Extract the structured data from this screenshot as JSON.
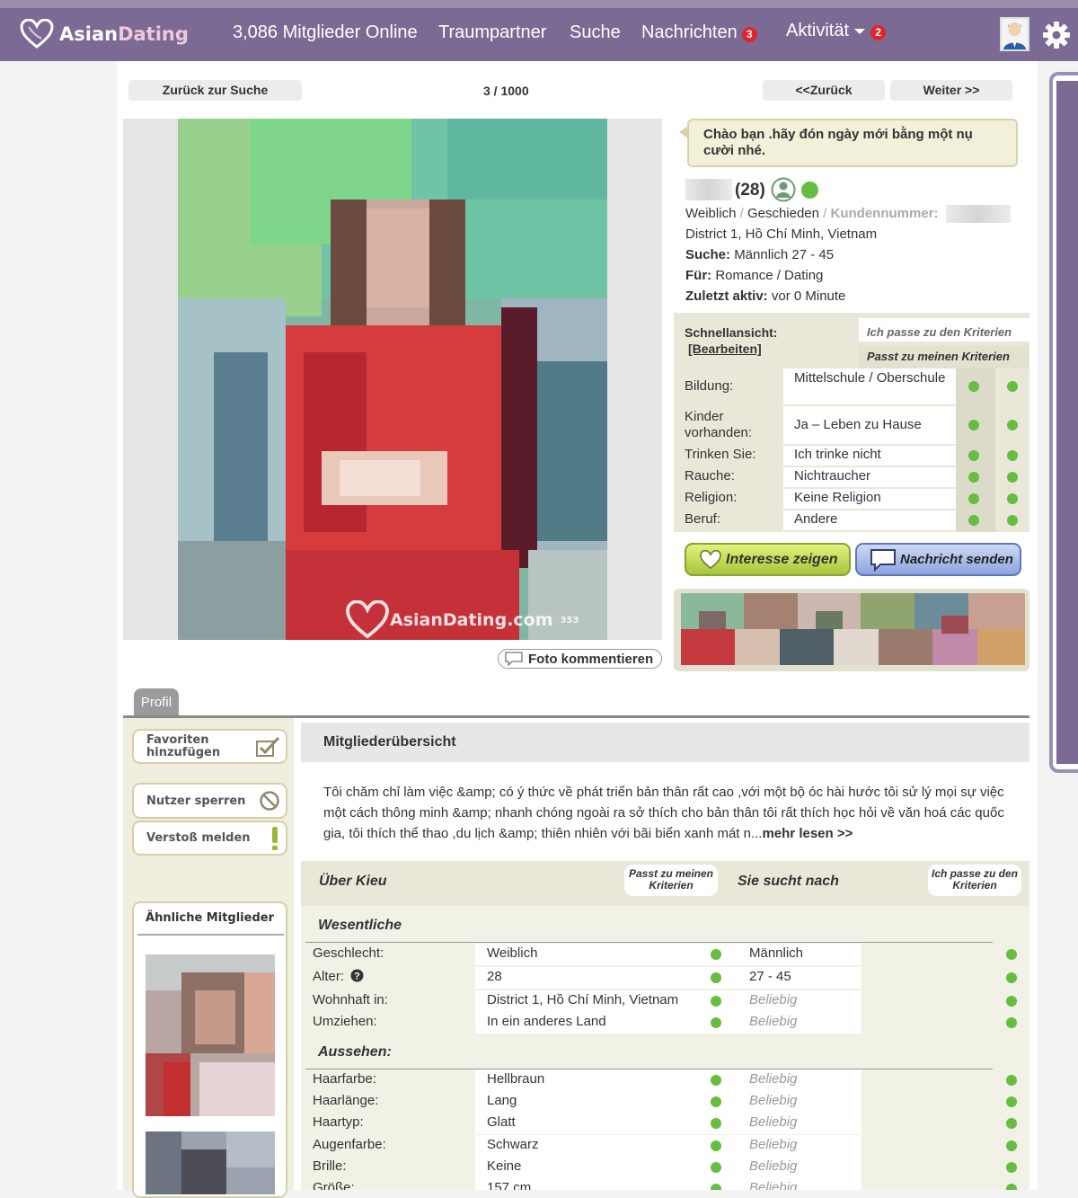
{
  "header": {
    "logo_asian": "Asian",
    "logo_dating": "Dating",
    "online": "3,086 Mitglieder Online",
    "nav_dream": "Traumpartner",
    "nav_search": "Suche",
    "nav_messages": "Nachrichten",
    "messages_badge": "3",
    "nav_activity": "Aktivität",
    "activity_badge": "2"
  },
  "toolbar": {
    "back_to_search": "Zurück zur Suche",
    "pager": "3 / 1000",
    "prev": "<<Zurück",
    "next": "Weiter >>"
  },
  "photo": {
    "watermark": "AsianDating.com",
    "watermark_num": "353",
    "comment_button": "Foto kommentieren"
  },
  "profile": {
    "greeting": "Chào bạn .hãy đón ngày mới bằng một nụ cười nhé.",
    "age": "(28)",
    "gender": "Weiblich",
    "status": "Geschieden",
    "customer_no_label": "Kundennummer:",
    "location": "District 1, Hồ Chí Minh, Vietnam",
    "seeking_label": "Suche:",
    "seeking": "Männlich 27 - 45",
    "for_label": "Für:",
    "for": "Romance / Dating",
    "last_active_label": "Zuletzt aktiv:",
    "last_active": "vor 0 Minute"
  },
  "quick": {
    "title": "Schnellansicht:",
    "edit": "[Bearbeiten]",
    "col1": "Ich passe zu den Kriterien",
    "col2": "Passt zu meinen Kriterien",
    "rows": [
      {
        "label": "Bildung:",
        "value": "Mittelschule / Oberschule"
      },
      {
        "label": "Kinder vorhanden:",
        "value": "Ja – Leben zu Hause"
      },
      {
        "label": "Trinken Sie:",
        "value": "Ich trinke nicht"
      },
      {
        "label": "Rauche:",
        "value": "Nichtraucher"
      },
      {
        "label": "Religion:",
        "value": "Keine Religion"
      },
      {
        "label": "Beruf:",
        "value": "Andere"
      }
    ]
  },
  "actions": {
    "interest": "Interesse zeigen",
    "message": "Nachricht senden"
  },
  "tabs": {
    "profile": "Profil"
  },
  "side": {
    "favorites": "Favoriten hinzufügen",
    "block": "Nutzer sperren",
    "report": "Verstoß melden",
    "similar": "Ähnliche Mitglieder"
  },
  "overview": {
    "title": "Mitgliederübersicht",
    "text": "Tôi chăm chỉ làm việc &amp; có ý thức về phát triển bản thân rất cao ,với một bộ óc hài hước tôi sử lý mọi sự việc một cách thông minh &amp; nhanh chóng ngoài ra sở thích cho bản thân tôi rất thích học hỏi về văn hoá các quốc gia, tôi thích thể thao ,du lịch &amp; thiên nhiên với bãi biển xanh mát n...",
    "more": "mehr lesen >>"
  },
  "details": {
    "about": "Über Kieu",
    "about_tag": "Passt zu meinen Kriterien",
    "seeking": "Sie sucht nach",
    "seeking_tag": "Ich passe zu den Kriterien",
    "section1": "Wesentliche",
    "section2": "Aussehen:",
    "rows1": [
      {
        "label": "Geschlecht:",
        "value": "Weiblich",
        "want": "Männlich"
      },
      {
        "label": "Alter:",
        "value": "28",
        "want": "27 - 45"
      },
      {
        "label": "Wohnhaft in:",
        "value": "District 1, Hồ Chí Minh, Vietnam",
        "want": "Beliebig"
      },
      {
        "label": "Umziehen:",
        "value": "In ein anderes Land",
        "want": "Beliebig"
      }
    ],
    "rows2": [
      {
        "label": "Haarfarbe:",
        "value": "Hellbraun",
        "want": "Beliebig"
      },
      {
        "label": "Haarlänge:",
        "value": "Lang",
        "want": "Beliebig"
      },
      {
        "label": "Haartyp:",
        "value": "Glatt",
        "want": "Beliebig"
      },
      {
        "label": "Augenfarbe:",
        "value": "Schwarz",
        "want": "Beliebig"
      },
      {
        "label": "Brille:",
        "value": "Keine",
        "want": "Beliebig"
      },
      {
        "label": "Größe:",
        "value": "157 cm",
        "want": "Beliebig"
      }
    ]
  },
  "colors": {
    "nav": "#7b6a93",
    "match_dot": "#65be3f",
    "badge": "#e0242b"
  }
}
